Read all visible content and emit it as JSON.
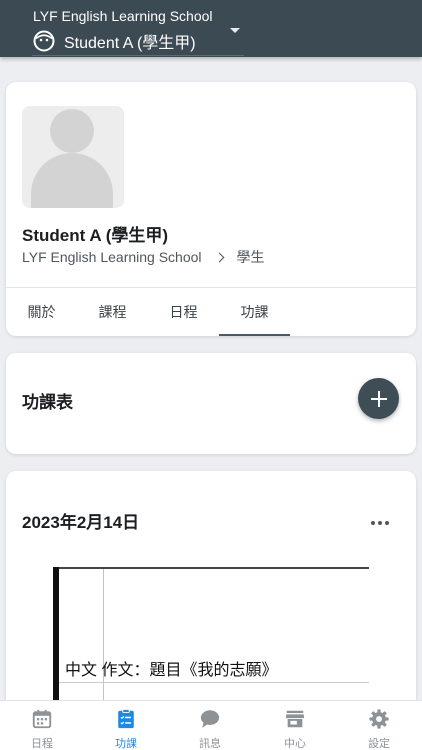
{
  "header": {
    "school": "LYF English Learning School",
    "student": "Student A (學生甲)"
  },
  "profile": {
    "name": "Student A (學生甲)",
    "school": "LYF English Learning School",
    "role": "學生",
    "tabs": [
      {
        "label": "關於",
        "active": false
      },
      {
        "label": "課程",
        "active": false
      },
      {
        "label": "日程",
        "active": false
      },
      {
        "label": "功課",
        "active": true
      }
    ]
  },
  "homework": {
    "title": "功課表",
    "entry": {
      "date": "2023年2月14日",
      "content": "中文  作文：題目《我的志願》"
    }
  },
  "bottom_nav": [
    {
      "label": "日程",
      "icon": "calendar-icon",
      "active": false
    },
    {
      "label": "功課",
      "icon": "clipboard-list-icon",
      "active": true
    },
    {
      "label": "訊息",
      "icon": "chat-bubble-icon",
      "active": false
    },
    {
      "label": "中心",
      "icon": "storefront-icon",
      "active": false
    },
    {
      "label": "設定",
      "icon": "gear-icon",
      "active": false
    }
  ],
  "colors": {
    "topbar": "#3c4a53",
    "accent": "#1e88e5",
    "fab": "#3f4d56",
    "nav_inactive": "#8d9297"
  }
}
